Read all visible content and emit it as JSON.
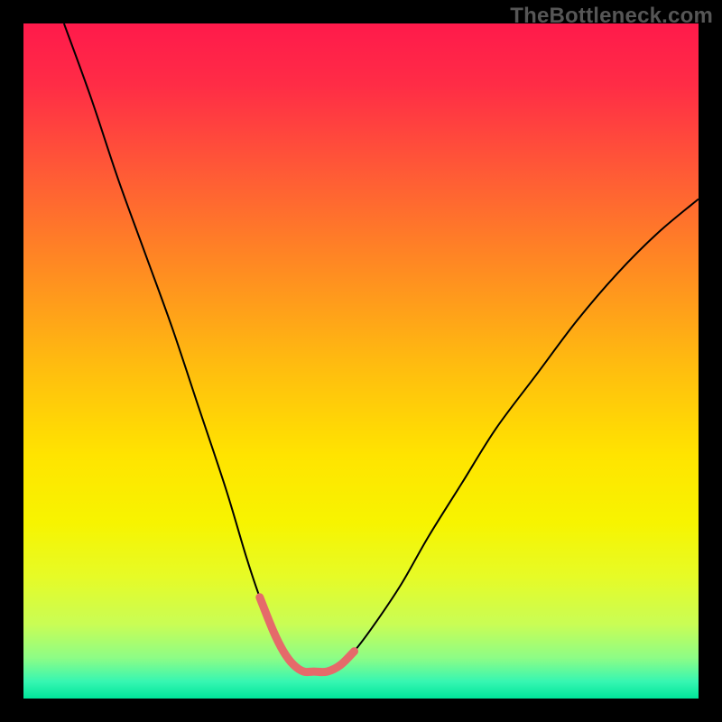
{
  "watermark": "TheBottleneck.com",
  "chart_data": {
    "type": "line",
    "title": "",
    "xlabel": "",
    "ylabel": "",
    "xlim": [
      0,
      100
    ],
    "ylim": [
      0,
      100
    ],
    "grid": false,
    "legend": false,
    "background_gradient": {
      "stops": [
        {
          "offset": 0.0,
          "color": "#ff1a4b"
        },
        {
          "offset": 0.09,
          "color": "#ff2c46"
        },
        {
          "offset": 0.22,
          "color": "#ff5a36"
        },
        {
          "offset": 0.36,
          "color": "#ff8a22"
        },
        {
          "offset": 0.5,
          "color": "#ffba10"
        },
        {
          "offset": 0.64,
          "color": "#ffe400"
        },
        {
          "offset": 0.74,
          "color": "#f7f400"
        },
        {
          "offset": 0.82,
          "color": "#e6fb27"
        },
        {
          "offset": 0.89,
          "color": "#c9fd55"
        },
        {
          "offset": 0.94,
          "color": "#8dfd86"
        },
        {
          "offset": 0.975,
          "color": "#36f6b2"
        },
        {
          "offset": 1.0,
          "color": "#00e59a"
        }
      ]
    },
    "series": [
      {
        "name": "bottleneck-curve",
        "stroke": "#000000",
        "stroke_width": 2,
        "x": [
          6,
          10,
          14,
          18,
          22,
          26,
          30,
          33,
          35,
          37,
          38.5,
          40,
          41.5,
          43,
          45,
          47,
          49,
          52,
          56,
          60,
          65,
          70,
          76,
          82,
          88,
          94,
          100
        ],
        "y": [
          100,
          89,
          77,
          66,
          55,
          43,
          31,
          21,
          15,
          10,
          7,
          5,
          4,
          4,
          4,
          5,
          7,
          11,
          17,
          24,
          32,
          40,
          48,
          56,
          63,
          69,
          74
        ]
      },
      {
        "name": "bottom-highlight",
        "stroke": "#e56a6a",
        "stroke_width": 9,
        "linecap": "round",
        "x": [
          35,
          37,
          38.5,
          40,
          41.5,
          43,
          45,
          47,
          49
        ],
        "y": [
          15,
          10,
          7,
          5,
          4,
          4,
          4,
          5,
          7
        ]
      }
    ]
  }
}
